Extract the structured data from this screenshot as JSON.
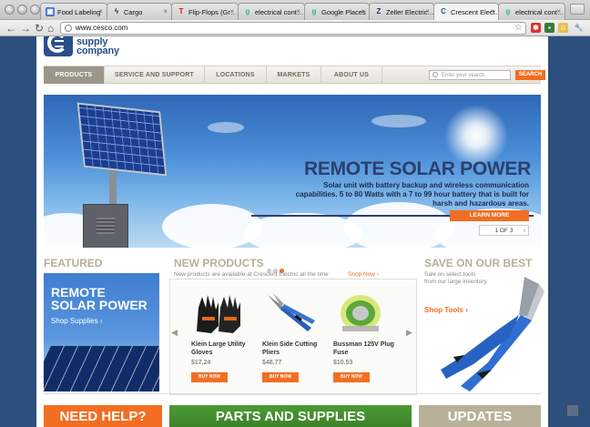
{
  "browser": {
    "tabs": [
      {
        "label": "Food Labeling",
        "icon": "food-labeling-favicon"
      },
      {
        "label": "Cargo",
        "icon": "cargo-favicon"
      },
      {
        "label": "Flip-Flops (Gr…",
        "icon": "target-favicon"
      },
      {
        "label": "electrical cont…",
        "icon": "google-favicon"
      },
      {
        "label": "Google Places",
        "icon": "google-favicon"
      },
      {
        "label": "Zeller Electric…",
        "icon": "zeller-favicon"
      },
      {
        "label": "Crescent Elect…",
        "icon": "crescent-favicon",
        "active": true
      },
      {
        "label": "electrical cont…",
        "icon": "google-favicon"
      }
    ],
    "url": "www.cesco.com"
  },
  "site": {
    "logo_line1": "supply",
    "logo_line2": "company",
    "nav": [
      "PRODUCTS",
      "SERVICE AND SUPPORT",
      "LOCATIONS",
      "MARKETS",
      "ABOUT US"
    ],
    "search_placeholder": "Enter your search",
    "search_button": "SEARCH"
  },
  "hero": {
    "title": "REMOTE SOLAR POWER",
    "text": "Solar unit with battery backup and wireless communication capabilities. 5 to 80 Watts with a 7 to 99 hour battery that is built for harsh and hazardous areas.",
    "button": "LEARN MORE",
    "pager": "1 OF 3"
  },
  "featured": {
    "heading": "FEATURED",
    "title_line1": "REMOTE",
    "title_line2": "SOLAR POWER",
    "link": "Shop Supplies"
  },
  "new_products": {
    "heading": "NEW PRODUCTS",
    "subtitle": "New products are available at Crescent Electric all the time",
    "link": "Shop Now",
    "items": [
      {
        "name": "Klein Large Utility Gloves",
        "price": "$17.24",
        "button": "BUY NOW"
      },
      {
        "name": "Klein Side Cutting Pliers",
        "price": "$48.77",
        "button": "BUY NOW"
      },
      {
        "name": "Bussman 125V Plug Fuse",
        "price": "$10.53",
        "button": "BUY NOW"
      }
    ]
  },
  "save": {
    "heading": "SAVE ON OUR BEST",
    "text": "Sale on select tools from our large inventory.",
    "link": "Shop Tools"
  },
  "promos": [
    "NEED HELP?",
    "PARTS AND SUPPLIES",
    "UPDATES"
  ],
  "colors": {
    "accent": "#f26e22",
    "brand": "#2a4f8a",
    "heading": "#b7b09a"
  }
}
